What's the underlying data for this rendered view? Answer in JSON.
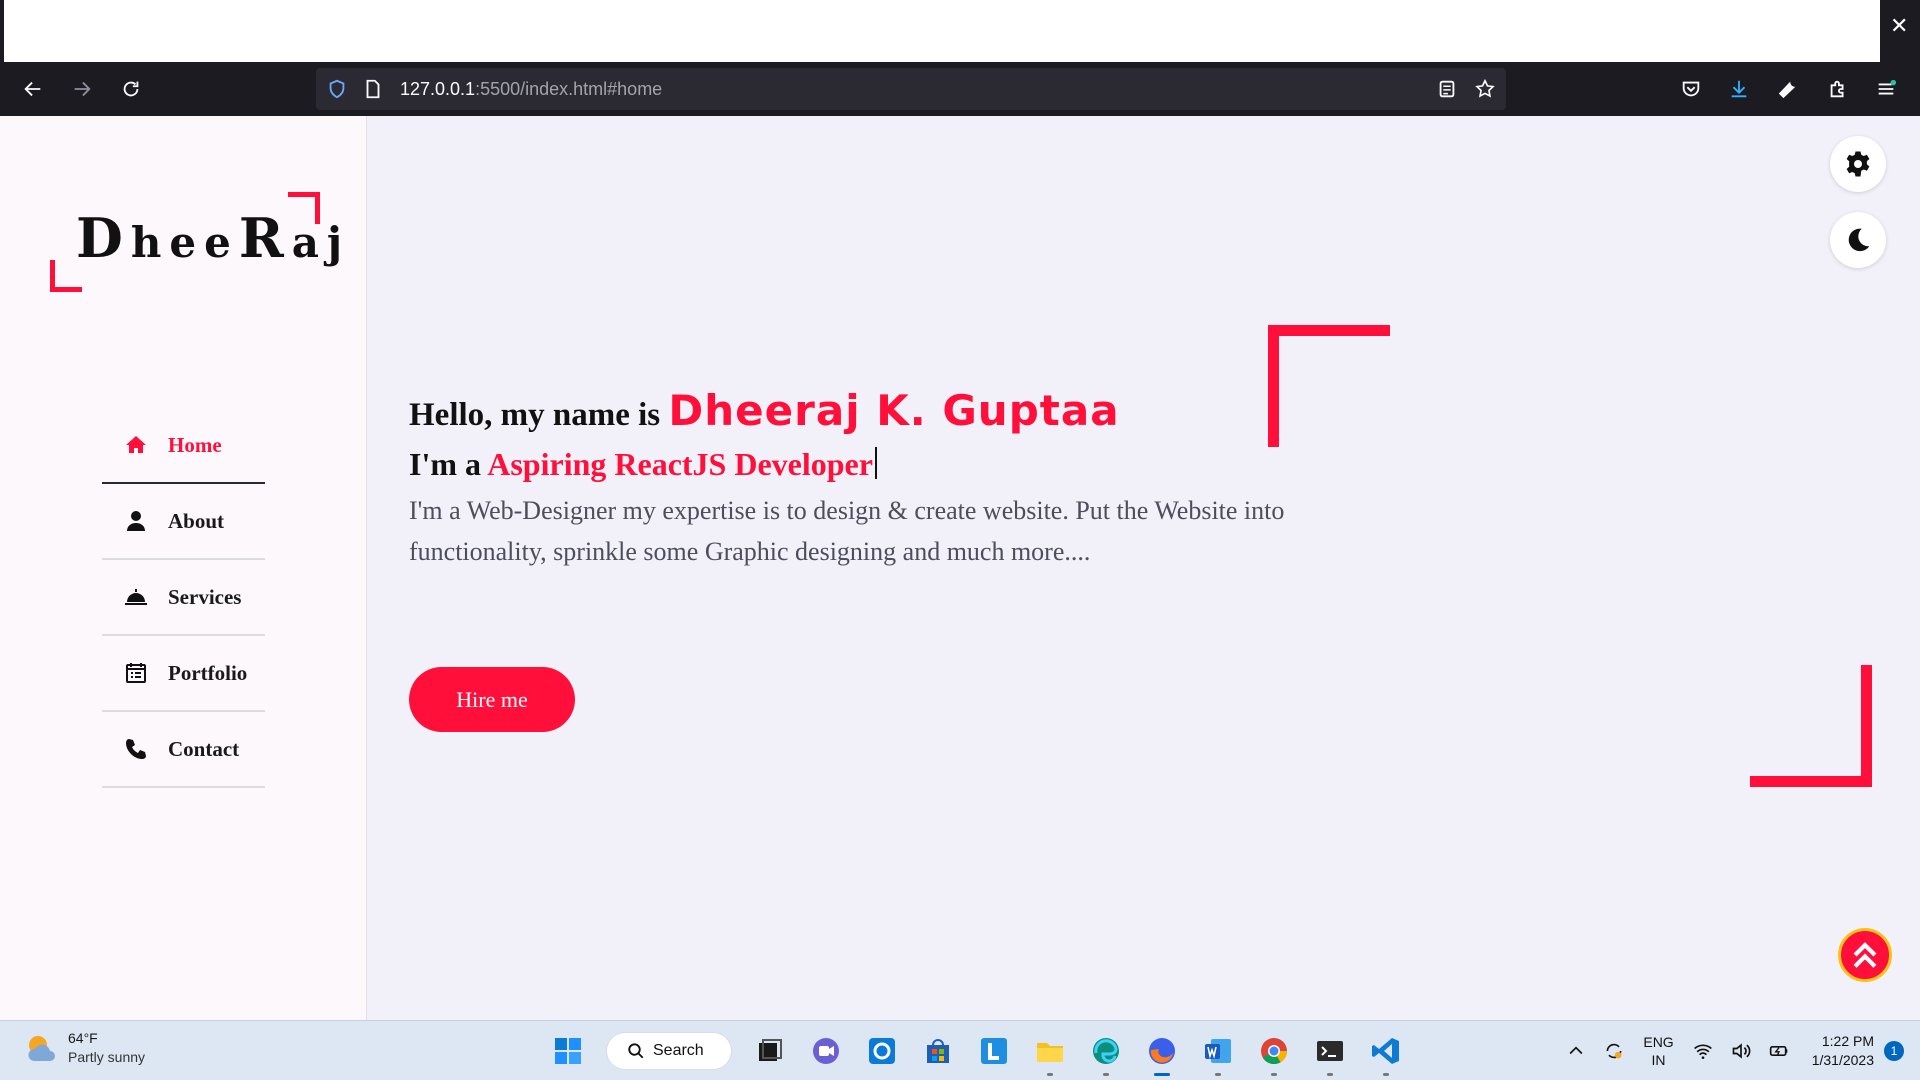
{
  "browser": {
    "url_host": "127.0.0.1",
    "url_rest": ":5500/index.html#home",
    "close_glyph": "✕"
  },
  "site": {
    "logo": {
      "c1": "D",
      "c2": "hee",
      "c3": "R",
      "c4": "aj"
    },
    "nav": [
      {
        "label": "Home",
        "icon": "home-icon"
      },
      {
        "label": "About",
        "icon": "user-icon"
      },
      {
        "label": "Services",
        "icon": "service-bell-icon"
      },
      {
        "label": "Portfolio",
        "icon": "calendar-list-icon"
      },
      {
        "label": "Contact",
        "icon": "phone-icon"
      }
    ],
    "hello_prefix": "Hello, my name is ",
    "hello_name": "Dheeraj K. Guptaa",
    "role_prefix": "I'm a ",
    "role_text": "Aspiring ReactJS Developer",
    "description": "I'm a Web-Designer my expertise is to design & create website. Put the Website into functionality, sprinkle some Graphic designing and much more....",
    "hire_label": "Hire me",
    "accent": "#ff0f3a"
  },
  "taskbar": {
    "weather_temp": "64°F",
    "weather_desc": "Partly sunny",
    "search_label": "Search",
    "lang_1": "ENG",
    "lang_2": "IN",
    "time": "1:22 PM",
    "date": "1/31/2023",
    "notifications": "1"
  }
}
